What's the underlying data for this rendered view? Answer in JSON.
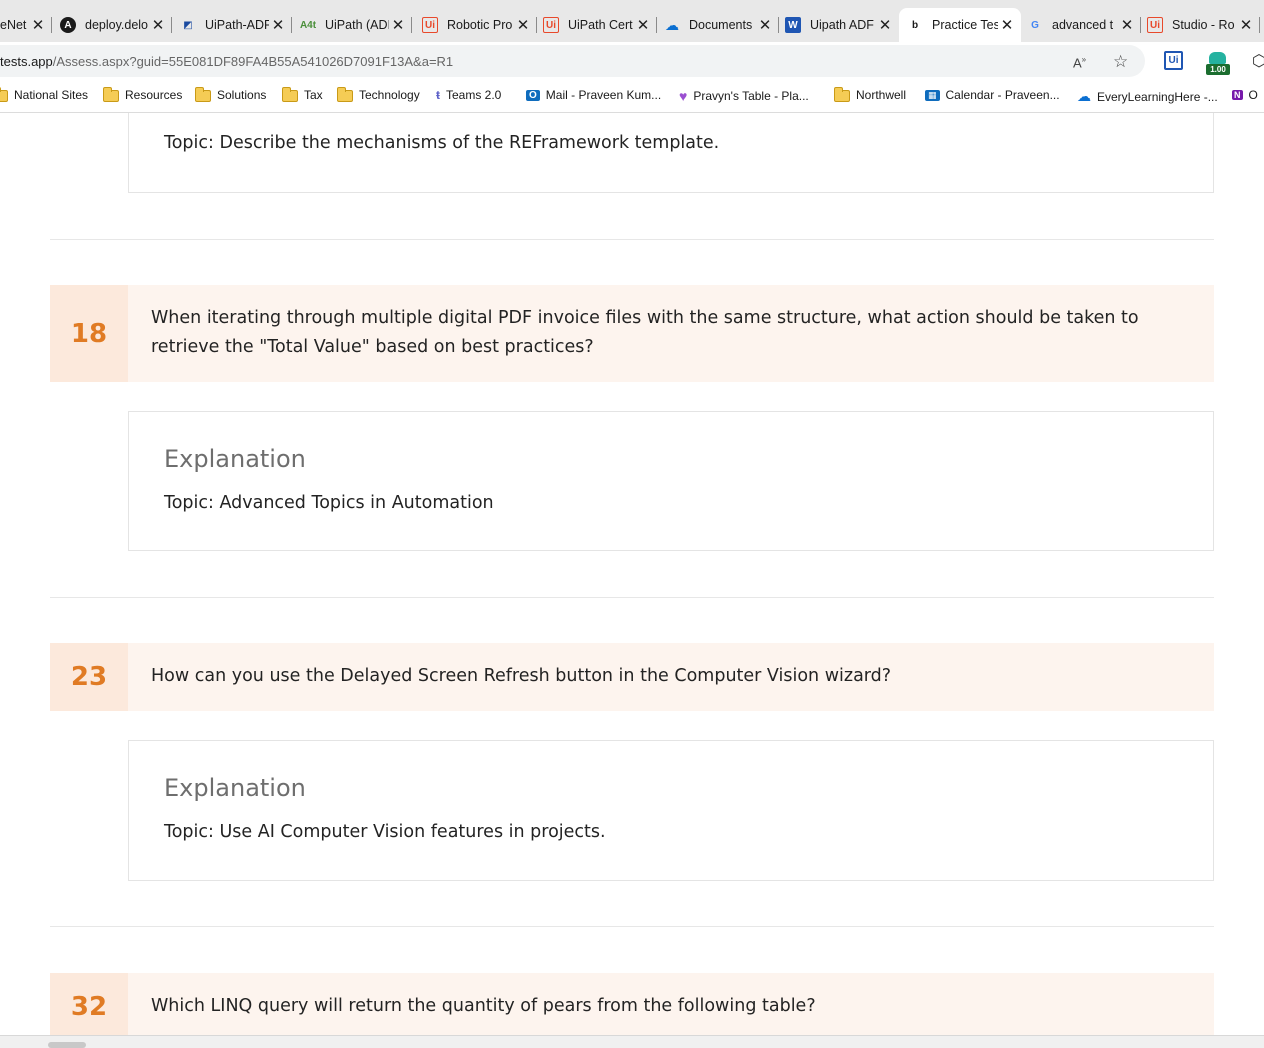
{
  "browser": {
    "tabs": [
      {
        "title": "eNet",
        "icon": "generic-icon",
        "active": false
      },
      {
        "title": "deploy.delo",
        "icon": "angular-icon",
        "active": false
      },
      {
        "title": "UiPath-ADF",
        "icon": "uipath-community-icon",
        "active": false
      },
      {
        "title": "UiPath (ADI",
        "icon": "a4t-icon",
        "active": false
      },
      {
        "title": "Robotic Pro",
        "icon": "uipath-icon",
        "active": false
      },
      {
        "title": "UiPath Cert",
        "icon": "uipath-icon",
        "active": false
      },
      {
        "title": "Documents",
        "icon": "onedrive-icon",
        "active": false
      },
      {
        "title": "Uipath ADF",
        "icon": "word-icon",
        "active": false
      },
      {
        "title": "Practice Tes",
        "icon": "bing-icon",
        "active": true
      },
      {
        "title": "advanced t",
        "icon": "google-icon",
        "active": false
      },
      {
        "title": "Studio - Ro",
        "icon": "uipath-icon",
        "active": false
      }
    ],
    "address": {
      "host": "tests.app",
      "path": "/Assess.aspx?guid=55E081DF89FA4B55A541026D7091F13A&a=R1"
    },
    "extensions": {
      "uipath_label": "Ui",
      "badge_label": "1.00"
    },
    "bookmarks": [
      {
        "label": "National Sites",
        "type": "folder"
      },
      {
        "label": "Resources",
        "type": "folder"
      },
      {
        "label": "Solutions",
        "type": "folder"
      },
      {
        "label": "Tax",
        "type": "folder"
      },
      {
        "label": "Technology",
        "type": "folder"
      },
      {
        "label": "Teams 2.0",
        "type": "teams"
      },
      {
        "label": "Mail - Praveen Kum...",
        "type": "outlook"
      },
      {
        "label": "Pravyn's Table - Pla...",
        "type": "heart"
      },
      {
        "label": "Northwell",
        "type": "folder"
      },
      {
        "label": "Calendar - Praveen...",
        "type": "calendar"
      },
      {
        "label": "EveryLearningHere -...",
        "type": "onedrive"
      },
      {
        "label": "O",
        "type": "onenote"
      }
    ]
  },
  "content": {
    "top_explanation_topic": "Topic: Describe the mechanisms of the REFramework template.",
    "questions": [
      {
        "number": "18",
        "text": "When iterating through multiple digital PDF invoice files with the same structure, what action should be taken to retrieve the \"Total Value\" based on best practices?",
        "explanation_heading": "Explanation",
        "explanation_topic": "Topic: Advanced Topics in Automation"
      },
      {
        "number": "23",
        "text": "How can you use the Delayed Screen Refresh button in the Computer Vision wizard?",
        "explanation_heading": "Explanation",
        "explanation_topic": "Topic: Use AI Computer Vision features in projects."
      },
      {
        "number": "32",
        "text": "Which LINQ query will return the quantity of pears from the following table?"
      }
    ]
  },
  "colors": {
    "accent_number": "#e07b24",
    "question_bg": "#fdf4ee",
    "number_bg": "#fce9dc"
  }
}
